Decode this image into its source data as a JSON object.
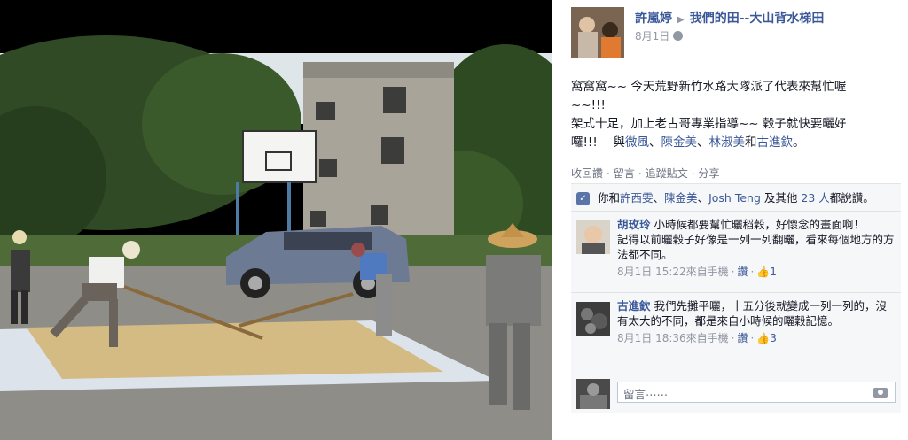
{
  "post": {
    "author": "許嵐婷",
    "group": "我們的田--大山背水梯田",
    "date": "8月1日",
    "text_line1": "窩窩窩~~ 今天荒野新竹水路大隊派了代表來幫忙喔",
    "text_line2": "~~!!!",
    "text_line3": "架式十足，加上老古哥專業指導~~ 穀子就快要曬好",
    "text_line4_prefix": "囉!!!— 與",
    "tagged": [
      "微風",
      "陳金美",
      "林淑美",
      "古進欽"
    ],
    "sep1": "、",
    "conj": "和",
    "end": "。"
  },
  "actions": {
    "unlike": "收回讚",
    "comment": "留言",
    "follow": "追蹤貼文",
    "share": "分享",
    "separator": "·"
  },
  "likes": {
    "thumb_icon": "👍",
    "prefix": "你和",
    "person1": "許西雯",
    "sep": "、",
    "person2": "陳金美",
    "person3": "Josh Teng",
    "middle": "及其他",
    "others": "23 人",
    "suffix": "都說讚。"
  },
  "comments": [
    {
      "name": "胡玫玲",
      "text": "小時候都要幫忙曬稻穀，好懷念的畫面啊！",
      "text2": "記得以前曬穀子好像是一列一列翻曬，看來每個地方的方法都不同。",
      "time": "8月1日 15:22來自手機",
      "like_label": "讚",
      "like_count": "1"
    },
    {
      "name": "古進欽",
      "text": "我們先攤平曬，十五分後就變成一列一列的，沒有太大的不同，都是來自小時候的曬穀記憶。",
      "time": "8月1日 18:36來自手機",
      "like_label": "讚",
      "like_count": "3"
    }
  ],
  "reply": {
    "placeholder": "留言⋯⋯"
  }
}
